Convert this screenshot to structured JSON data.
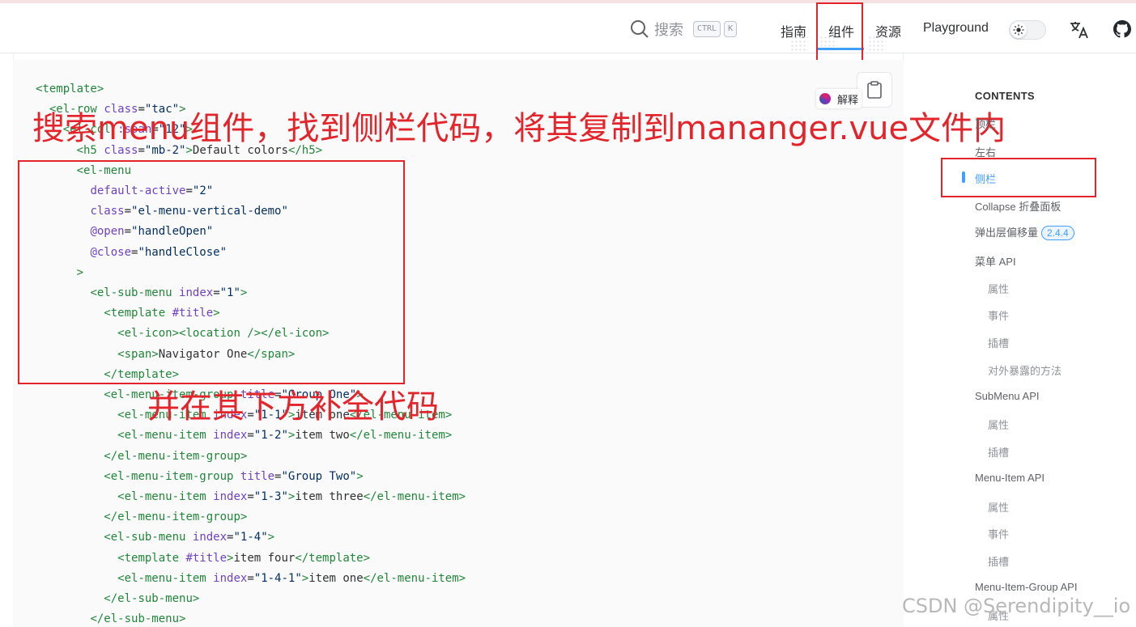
{
  "header": {
    "search_placeholder": "搜索",
    "shortcut_keys": [
      "CTRL",
      "K"
    ],
    "nav": [
      "指南",
      "组件",
      "资源",
      "Playground"
    ],
    "active_nav": "组件",
    "accent_color": "#409eff"
  },
  "code_toolbar": {
    "ai_chip_label": "解释"
  },
  "annotations": {
    "top": "搜索menu组件，找到侧栏代码，将其复制到mananger.vue文件内",
    "middle": "并在其下方补全代码",
    "color": "#e3242b"
  },
  "toc": {
    "title": "CONTENTS",
    "items": [
      "顶栏",
      "左右",
      "侧栏",
      "Collapse 折叠面板",
      "弹出层偏移量",
      "菜单 API",
      "属性",
      "事件",
      "插槽",
      "对外暴露的方法",
      "SubMenu API",
      "属性",
      "插槽",
      "Menu-Item API",
      "属性",
      "事件",
      "插槽",
      "Menu-Item-Group API",
      "属性"
    ],
    "badge": "2.4.4"
  },
  "watermark": "CSDN @Serendipity__io",
  "icons": [
    "search-icon",
    "sun-icon",
    "translate-icon",
    "github-icon",
    "copy-icon"
  ]
}
